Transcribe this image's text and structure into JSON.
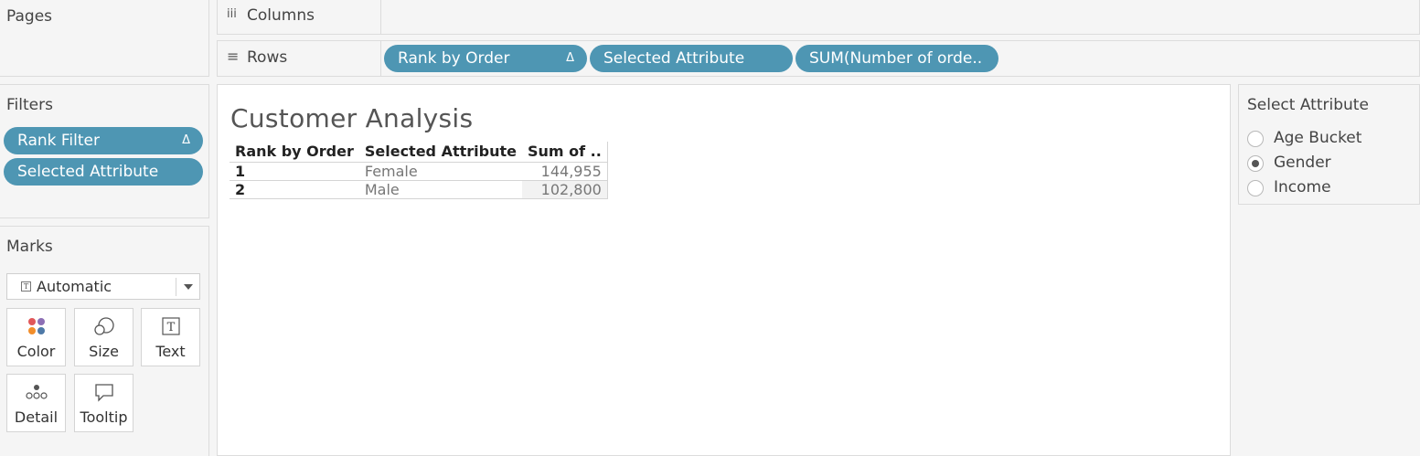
{
  "pages": {
    "title": "Pages"
  },
  "shelves": {
    "columns": {
      "icon": "iii",
      "label": "Columns"
    },
    "rows": {
      "icon": "≡",
      "label": "Rows",
      "pills": [
        "Rank by Order",
        "Selected Attribute",
        "SUM(Number of orde.."
      ],
      "pill_delta": "Δ"
    }
  },
  "filters": {
    "title": "Filters",
    "pills": [
      "Rank Filter",
      "Selected Attribute"
    ],
    "pill_delta": "Δ"
  },
  "marks": {
    "title": "Marks",
    "type_icon": "T",
    "type": "Automatic",
    "buttons": [
      "Color",
      "Size",
      "Text",
      "Detail",
      "Tooltip"
    ]
  },
  "view": {
    "title": "Customer Analysis",
    "headers": [
      "Rank by Order",
      "Selected Attribute",
      "Sum of .."
    ],
    "rows": [
      {
        "rank": "1",
        "attr": "Female",
        "value": "144,955"
      },
      {
        "rank": "2",
        "attr": "Male",
        "value": "102,800"
      }
    ]
  },
  "parameter": {
    "title": "Select Attribute",
    "options": [
      "Age Bucket",
      "Gender",
      "Income"
    ],
    "selected": "Gender"
  },
  "colors": {
    "pill": "#4e96b3",
    "panel": "#f5f5f5",
    "border": "#dcdcdc"
  }
}
